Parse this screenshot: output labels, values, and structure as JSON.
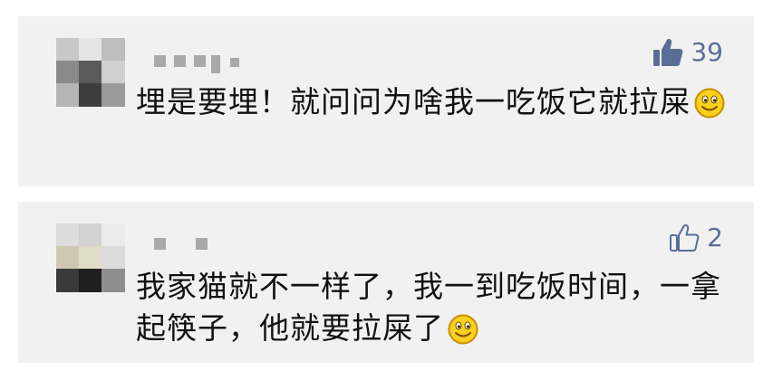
{
  "comments": [
    {
      "likes": "39",
      "liked": true,
      "text": "埋是要埋！就问问为啥我一吃饭它就拉屎",
      "emoji": "smile-emoji-icon"
    },
    {
      "likes": "2",
      "liked": false,
      "text": "我家猫就不一样了，我一到吃饭时间，一拿起筷子，他就要拉屎了",
      "emoji": "smile-emoji-icon"
    }
  ],
  "colors": {
    "card_bg": "#f1f1f1",
    "like_blue": "#5a6e95",
    "text": "#111111"
  }
}
